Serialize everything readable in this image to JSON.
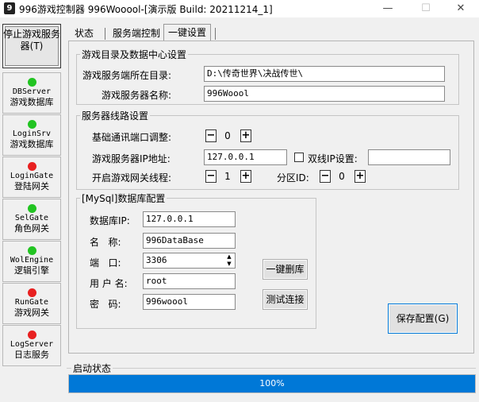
{
  "window": {
    "icon_glyph": "9",
    "title": "996游戏控制器   996Wooool-[演示版 Build: 20211214_1]",
    "min_glyph": "—",
    "max_glyph": "☐",
    "close_glyph": "✕"
  },
  "sidebar": {
    "stop_button": "停止游戏服务器(T)",
    "services": [
      {
        "name": "DBServer",
        "desc": "游戏数据库",
        "status_color": "#22c422"
      },
      {
        "name": "LoginSrv",
        "desc": "游戏数据库",
        "status_color": "#22c422"
      },
      {
        "name": "LoginGate",
        "desc": "登陆网关",
        "status_color": "#e82020"
      },
      {
        "name": "SelGate",
        "desc": "角色网关",
        "status_color": "#22c422"
      },
      {
        "name": "WolEngine",
        "desc": "逻辑引擎",
        "status_color": "#22c422"
      },
      {
        "name": "RunGate",
        "desc": "游戏网关",
        "status_color": "#e82020"
      },
      {
        "name": "LogServer",
        "desc": "日志服务",
        "status_color": "#e82020"
      }
    ]
  },
  "tabs": [
    {
      "label": "状态",
      "active": false
    },
    {
      "label": "服务端控制",
      "active": false
    },
    {
      "label": "一键设置",
      "active": true
    }
  ],
  "dir_group": {
    "legend": "游戏目录及数据中心设置",
    "dir_label": "游戏服务端所在目录:",
    "dir_value": "D:\\传奇世界\\决战传世\\",
    "name_label": "游戏服务器名称:",
    "name_value": "996Woool"
  },
  "line_group": {
    "legend": "服务器线路设置",
    "port_label": "基础通讯端口调整:",
    "port_value": "0",
    "ip_label": "游戏服务器IP地址:",
    "ip_value": "127.0.0.1",
    "dual_ip_label": "双线IP设置:",
    "dual_ip_value": "",
    "dual_ip_checked": false,
    "gate_label": "开启游戏网关线程:",
    "gate_value": "1",
    "zone_label": "分区ID:",
    "zone_value": "0",
    "minus": "−",
    "plus": "+"
  },
  "mysql_group": {
    "legend": "[MySql]数据库配置",
    "ip_label": "数据库IP:",
    "ip_value": "127.0.0.1",
    "name_label": "名   称:",
    "name_value": "996DataBase",
    "port_label": "端   口:",
    "port_value": "3306",
    "user_label": "用 户 名:",
    "user_value": "root",
    "pwd_label": "密   码:",
    "pwd_value": "996woool",
    "delete_button": "一键删库",
    "test_button": "测试连接",
    "spin_up": "▲",
    "spin_down": "▼"
  },
  "save_button": "保存配置(G)",
  "startup": {
    "label": "启动状态",
    "progress": 100,
    "progress_text": "100%"
  }
}
